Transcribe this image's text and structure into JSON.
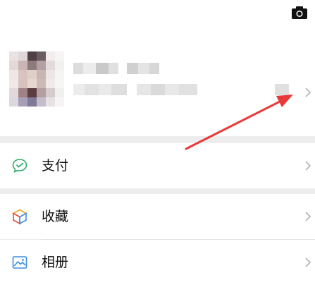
{
  "header": {
    "camera_icon": "camera-icon"
  },
  "profile": {
    "avatar_icon": "avatar-pixelated",
    "chevron_icon": "chevron-right-icon"
  },
  "menu": {
    "items": [
      {
        "label": "支付",
        "icon": "wechat-pay-icon"
      },
      {
        "label": "收藏",
        "icon": "favorites-cube-icon"
      },
      {
        "label": "相册",
        "icon": "album-icon"
      }
    ]
  },
  "colors": {
    "arrow": "#e8393b",
    "pay_icon": "#2aae67",
    "chevron": "#b2b2b2",
    "background": "#ededed"
  }
}
